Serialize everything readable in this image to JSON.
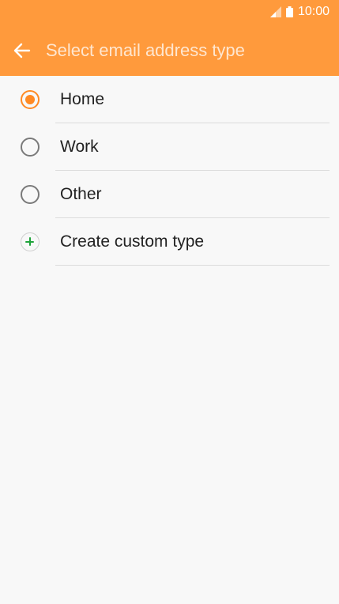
{
  "status_bar": {
    "time": "10:00",
    "icons": [
      "signal-icon",
      "battery-icon"
    ]
  },
  "header": {
    "title": "Select email address type",
    "back_icon": "arrow-left-icon",
    "color": "#ff9a3c"
  },
  "options": [
    {
      "label": "Home",
      "selected": true
    },
    {
      "label": "Work",
      "selected": false
    },
    {
      "label": "Other",
      "selected": false
    }
  ],
  "create_custom": {
    "label": "Create custom type",
    "icon": "plus-circle-icon",
    "color": "#1fa33a"
  },
  "accent_color": "#ff8a24"
}
